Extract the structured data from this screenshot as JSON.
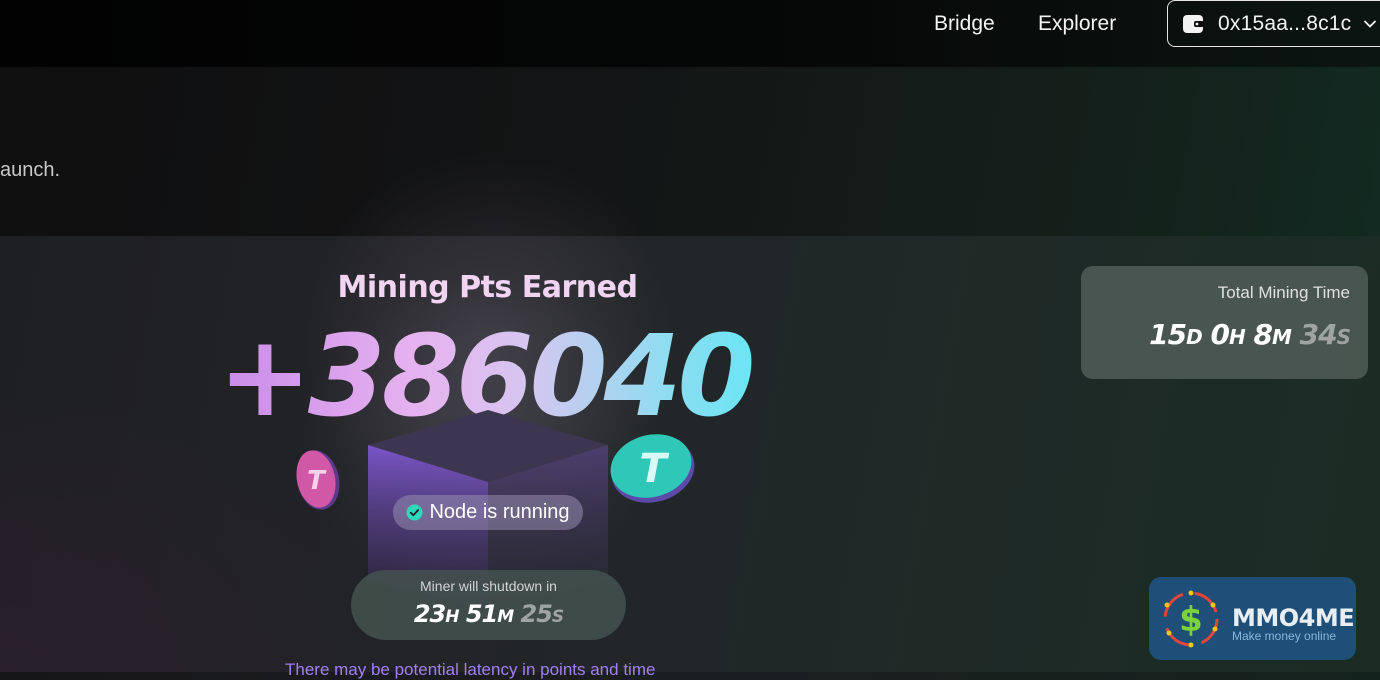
{
  "nav": {
    "bridge_label": "Bridge",
    "explorer_label": "Explorer",
    "wallet_address": "0x15aa...8c1c",
    "wallet_icon": "wallet-icon",
    "chevron_icon": "chevron-down-icon"
  },
  "banner": {
    "text": "aunch."
  },
  "mining": {
    "title": "Mining Pts Earned",
    "points": "+386040",
    "status": "Node is running",
    "status_icon": "check-circle-icon"
  },
  "shutdown": {
    "label": "Miner will shutdown in",
    "hours": "23",
    "hours_unit": "H",
    "minutes": "51",
    "minutes_unit": "M",
    "seconds": "25",
    "seconds_unit": "S"
  },
  "total": {
    "label": "Total Mining Time",
    "days": "15",
    "days_unit": "D",
    "hours": "0",
    "hours_unit": "H",
    "minutes": "8",
    "minutes_unit": "M",
    "seconds": "34",
    "seconds_unit": "S"
  },
  "notice": {
    "text": "There may be potential latency in points and time"
  },
  "logo": {
    "name": "MMO4ME",
    "tagline": "Make money online",
    "symbol": "$"
  },
  "colors": {
    "accent_purple": "#c88be8",
    "accent_cyan": "#5fe8f5",
    "status_green": "#2fd8b8",
    "notice_purple": "#a27ff0"
  }
}
